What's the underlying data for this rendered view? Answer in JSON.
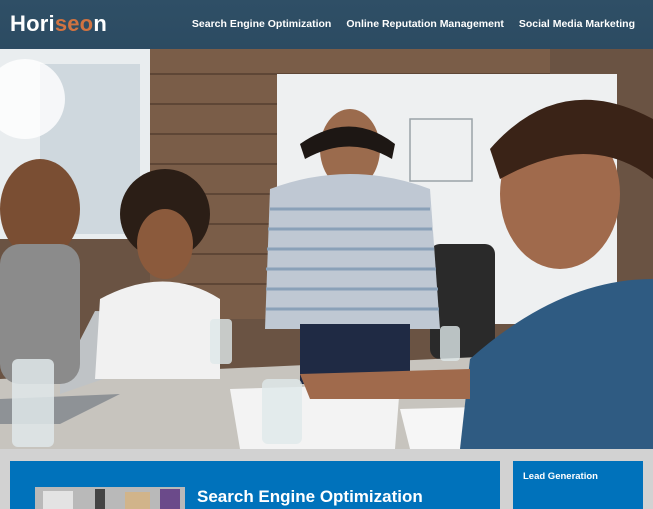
{
  "header": {
    "logo_main": "Hori",
    "logo_accent": "seo",
    "logo_tail": "n",
    "nav": [
      {
        "label": "Search Engine Optimization"
      },
      {
        "label": "Online Reputation Management"
      },
      {
        "label": "Social Media Marketing"
      }
    ]
  },
  "colors": {
    "header_bg": "#2c4b62",
    "logo_accent": "#d07341",
    "card_bg": "#0072bb",
    "band_bg": "#d2d2d2"
  },
  "hero": {
    "icon": "hero-image"
  },
  "cards": {
    "seo_title": "Search Engine Optimization",
    "lead_title": "Lead Generation"
  }
}
